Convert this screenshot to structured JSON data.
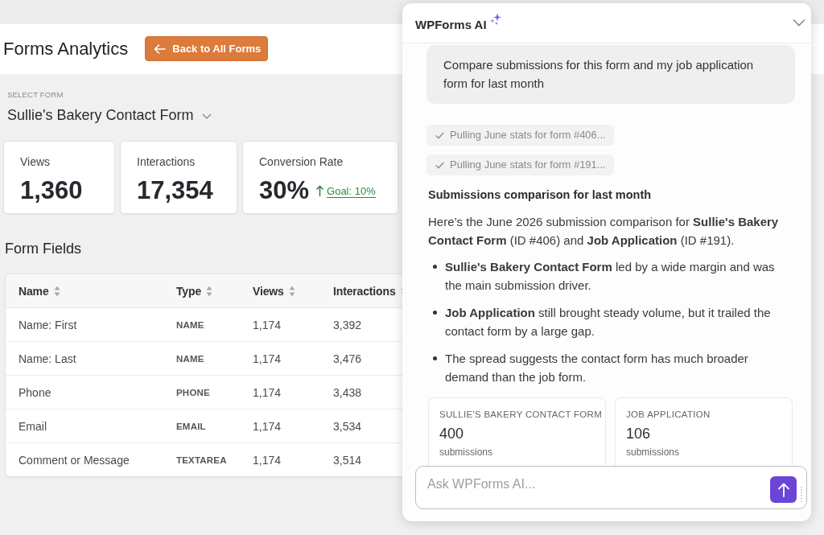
{
  "page": {
    "title": "Forms Analytics",
    "back_button": "Back to All Forms"
  },
  "form_select": {
    "label": "SELECT FORM",
    "value": "Sullie's Bakery Contact Form"
  },
  "stats": [
    {
      "label": "Views",
      "value": "1,360"
    },
    {
      "label": "Interactions",
      "value": "17,354"
    },
    {
      "label": "Conversion Rate",
      "value": "30%",
      "goal": "Goal: 10%"
    }
  ],
  "form_fields": {
    "title": "Form Fields",
    "columns": [
      "Name",
      "Type",
      "Views",
      "Interactions"
    ],
    "rows": [
      [
        "Name: First",
        "NAME",
        "1,174",
        "3,392"
      ],
      [
        "Name: Last",
        "NAME",
        "1,174",
        "3,476"
      ],
      [
        "Phone",
        "PHONE",
        "1,174",
        "3,438"
      ],
      [
        "Email",
        "EMAIL",
        "1,174",
        "3,534"
      ],
      [
        "Comment or Message",
        "TEXTAREA",
        "1,174",
        "3,514"
      ]
    ]
  },
  "assistant": {
    "title": "WPForms AI",
    "user_message": "Compare submissions for this form and my job application form for last month",
    "steps": [
      {
        "text": "Pulling June stats for form #406...",
        "done": true
      },
      {
        "text": "Pulling June stats for form #191...",
        "done": true
      }
    ],
    "reply": {
      "heading": "Submissions comparison for last month",
      "paragraph": "Here’s the June 2026 submission comparison for **Sullie's Bakery Contact Form** (ID #406) and **Job Application** (ID #191).",
      "bullets": [
        "**Sullie's Bakery Contact Form** led by a wide margin and was the main submission driver.",
        "**Job Application** still brought steady volume, but it trailed the contact form by a large gap.",
        "The spread suggests the contact form has much broader demand than the job form."
      ],
      "cards": [
        {
          "label": "SULLIE'S BAKERY CONTACT FORM",
          "value": "400",
          "unit": "submissions"
        },
        {
          "label": "JOB APPLICATION",
          "value": "106",
          "unit": "submissions"
        }
      ]
    },
    "input": {
      "placeholder": "Ask WPForms AI..."
    }
  }
}
